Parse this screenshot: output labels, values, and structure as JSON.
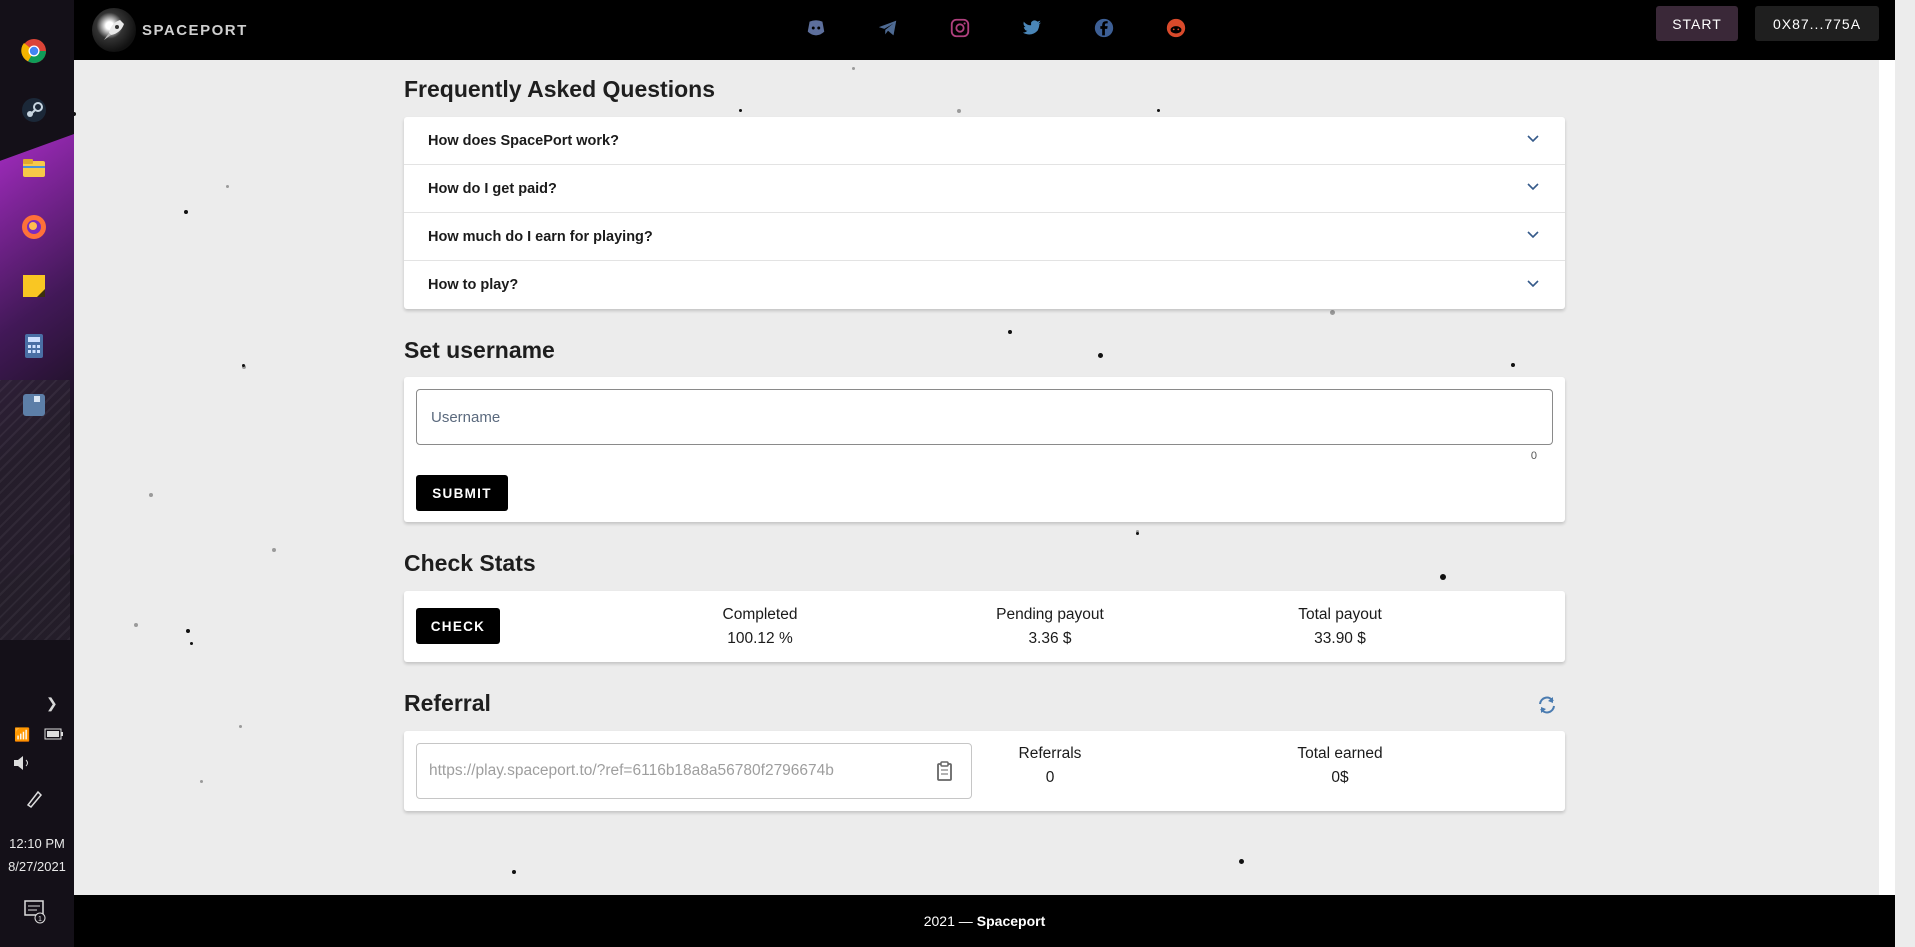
{
  "taskbar": {
    "time": "12:10 PM",
    "date": "8/27/2021",
    "notification_count": "1",
    "icons": [
      "chrome-icon",
      "steam-icon",
      "file-explorer-icon",
      "firefox-icon",
      "sticky-notes-icon",
      "calculator-icon",
      "app-icon"
    ]
  },
  "nav": {
    "logo_text": "SPACEPORT",
    "socials": [
      "discord-icon",
      "telegram-icon",
      "instagram-icon",
      "twitter-icon",
      "facebook-icon",
      "reddit-icon"
    ],
    "start_label": "START",
    "wallet_label": "0X87...775A"
  },
  "faq": {
    "title": "Frequently Asked Questions",
    "items": [
      {
        "question": "How does SpacePort work?"
      },
      {
        "question": "How do I get paid?"
      },
      {
        "question": "How much do I earn for playing?"
      },
      {
        "question": "How to play?"
      }
    ]
  },
  "username": {
    "title": "Set username",
    "placeholder": "Username",
    "value": "",
    "counter": "0",
    "submit_label": "SUBMIT"
  },
  "stats": {
    "title": "Check Stats",
    "check_label": "CHECK",
    "completed_label": "Completed",
    "completed_value": "100.12 %",
    "pending_label": "Pending payout",
    "pending_value": "3.36 $",
    "total_label": "Total payout",
    "total_value": "33.90 $"
  },
  "referral": {
    "title": "Referral",
    "link": "https://play.spaceport.to/?ref=6116b18a8a56780f2796674b",
    "referrals_label": "Referrals",
    "referrals_value": "0",
    "earned_label": "Total earned",
    "earned_value": "0$"
  },
  "footer": {
    "year": "2021 —",
    "brand": "Spaceport"
  },
  "colors": {
    "nav_bg": "#000000",
    "start_bg": "#3a2838",
    "page_bg": "#ececec",
    "button_bg": "#000000"
  }
}
